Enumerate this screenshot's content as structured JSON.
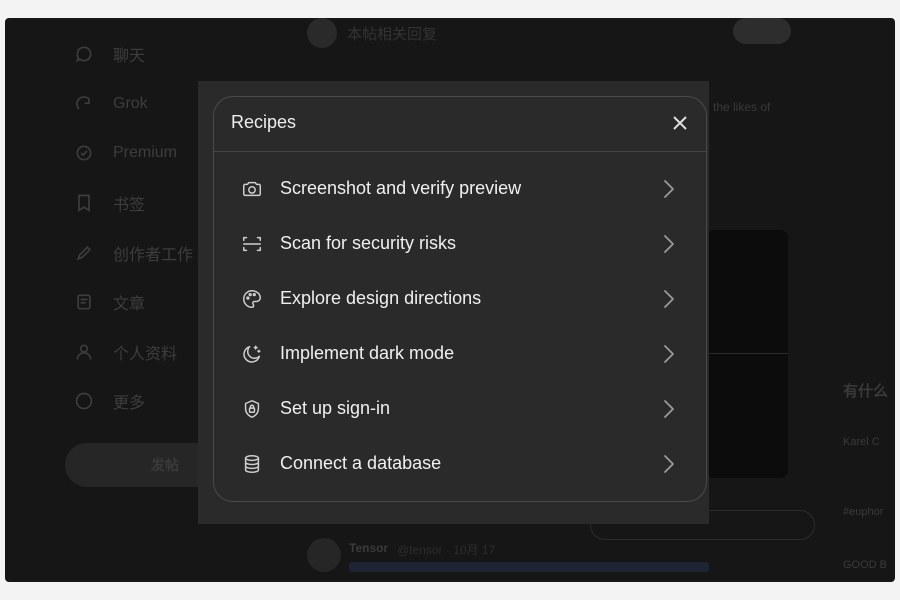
{
  "background": {
    "sidebar": {
      "items": [
        {
          "label": "聊天",
          "icon": "chat-icon"
        },
        {
          "label": "Grok",
          "icon": "grok-icon"
        },
        {
          "label": "Premium",
          "icon": "premium-icon"
        },
        {
          "label": "书签",
          "icon": "bookmark-icon"
        },
        {
          "label": "创作者工作",
          "icon": "creator-icon"
        },
        {
          "label": "文章",
          "icon": "article-icon"
        },
        {
          "label": "个人资料",
          "icon": "profile-icon"
        },
        {
          "label": "更多",
          "icon": "more-icon"
        }
      ],
      "post_button": "发帖"
    },
    "main": {
      "top_title": "本帖相关回复",
      "side_text": "the likes of",
      "feed_author": "Tensor",
      "feed_handle": "@tensor · 10月 17"
    },
    "right": {
      "heading": "有什么",
      "items": [
        "Karel C",
        "#euphor",
        "GOOD B"
      ]
    }
  },
  "modal": {
    "title": "Recipes",
    "close_icon": "close-icon",
    "items": [
      {
        "label": "Screenshot and verify preview",
        "icon": "camera-icon"
      },
      {
        "label": "Scan for security risks",
        "icon": "scan-icon"
      },
      {
        "label": "Explore design directions",
        "icon": "palette-icon"
      },
      {
        "label": "Implement dark mode",
        "icon": "moon-icon"
      },
      {
        "label": "Set up sign-in",
        "icon": "shield-lock-icon"
      },
      {
        "label": "Connect a database",
        "icon": "database-icon"
      }
    ]
  },
  "colors": {
    "modal_background": "#2a2a2a",
    "modal_border": "#4a4a4a",
    "text_primary": "#f0f0f0"
  }
}
